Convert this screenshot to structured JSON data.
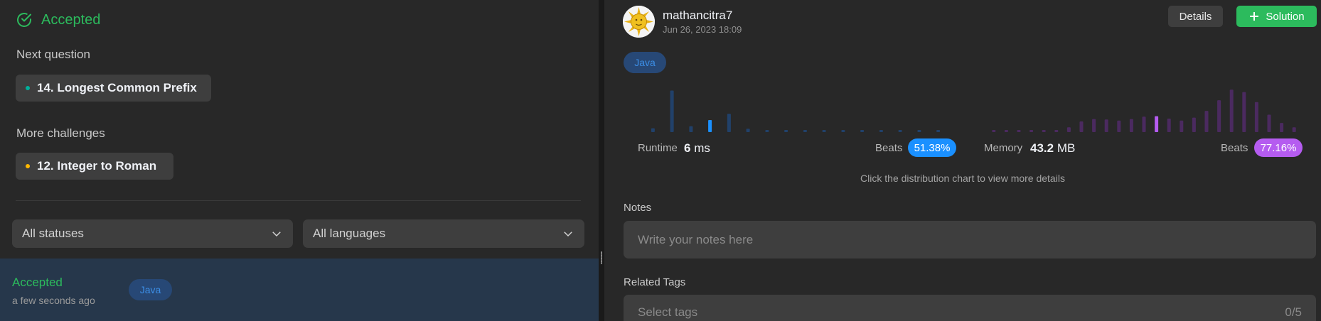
{
  "result": {
    "status": "Accepted"
  },
  "next_question": {
    "label": "Next question",
    "title": "14. Longest Common Prefix",
    "dot_color": "#00af9b"
  },
  "more_challenges": {
    "label": "More challenges",
    "title": "12. Integer to Roman",
    "dot_color": "#ffb800"
  },
  "filters": {
    "status": "All statuses",
    "language": "All languages"
  },
  "submission_row": {
    "status": "Accepted",
    "time": "a few seconds ago",
    "language": "Java"
  },
  "submission": {
    "username": "mathancitra7",
    "date": "Jun 26, 2023 18:09",
    "language": "Java",
    "details_label": "Details",
    "solution_label": "Solution"
  },
  "runtime": {
    "label": "Runtime",
    "value": "6",
    "unit": "ms",
    "beats_label": "Beats",
    "beats": "51.38%",
    "accent": "#1a90ff"
  },
  "memory": {
    "label": "Memory",
    "value": "43.2",
    "unit": "MB",
    "beats_label": "Beats",
    "beats": "77.16%",
    "accent": "#b55cf0"
  },
  "hint": "Click the distribution chart to view more details",
  "notes": {
    "label": "Notes",
    "placeholder": "Write your notes here"
  },
  "related_tags": {
    "label": "Related Tags",
    "placeholder": "Select tags",
    "count": "0/5"
  },
  "chart_data": [
    {
      "type": "bar",
      "name": "runtime-distribution",
      "values": [
        0.08,
        0.86,
        0.12,
        0.25,
        0.38,
        0.07,
        0.03,
        0.03,
        0.03,
        0.03,
        0.03,
        0.03,
        0.03,
        0.03,
        0.03,
        0.03
      ],
      "highlight_index": 3
    },
    {
      "type": "bar",
      "name": "memory-distribution",
      "values": [
        0.04,
        0.04,
        0.04,
        0.04,
        0.04,
        0.04,
        0.1,
        0.22,
        0.27,
        0.26,
        0.24,
        0.27,
        0.32,
        0.33,
        0.28,
        0.24,
        0.3,
        0.44,
        0.66,
        0.88,
        0.83,
        0.62,
        0.36,
        0.19,
        0.1
      ],
      "highlight_index": 13
    }
  ]
}
